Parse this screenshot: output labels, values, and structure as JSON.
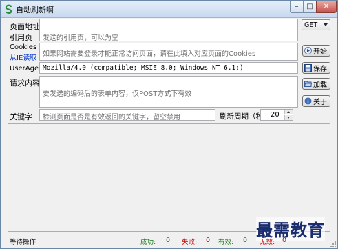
{
  "window": {
    "title": "自动刷新啊",
    "icon": "refresh-s-icon"
  },
  "form": {
    "url_label": "页面地址",
    "url_value": "",
    "method_value": "GET",
    "referer_label": "引用页",
    "referer_placeholder": "发送的引用页，可以为空",
    "cookies_label": "Cookies",
    "cookies_link": "从IE读取",
    "cookies_placeholder": "如果网站需要登录才能正常访问页面，请在此填入对应页面的Cookies",
    "useragent_label": "UserAgent",
    "useragent_value": "Mozilla/4.0 (compatible; MSIE 8.0; Windows NT 6.1;)",
    "body_label": "请求内容",
    "body_placeholder": "要发送的编码后的表单内容，仅POST方式下有效",
    "keyword_label": "关键字",
    "keyword_placeholder": "检测页面是否是有效返回的关键字，留空禁用",
    "period_label": "刷新周期（秒）",
    "period_value": "20"
  },
  "buttons": {
    "start": "开始",
    "save": "保存",
    "load": "加载",
    "about": "关于"
  },
  "status": {
    "state": "等待操作",
    "success_label": "成功:",
    "success_value": "0",
    "fail_label": "失败:",
    "fail_value": "0",
    "valid_label": "有效:",
    "valid_value": "0",
    "invalid_label": "无效:",
    "invalid_value": "0"
  },
  "watermark": "最需教育",
  "colors": {
    "success": "#1a7a1a",
    "fail": "#cc0000",
    "link": "#0033cc"
  }
}
